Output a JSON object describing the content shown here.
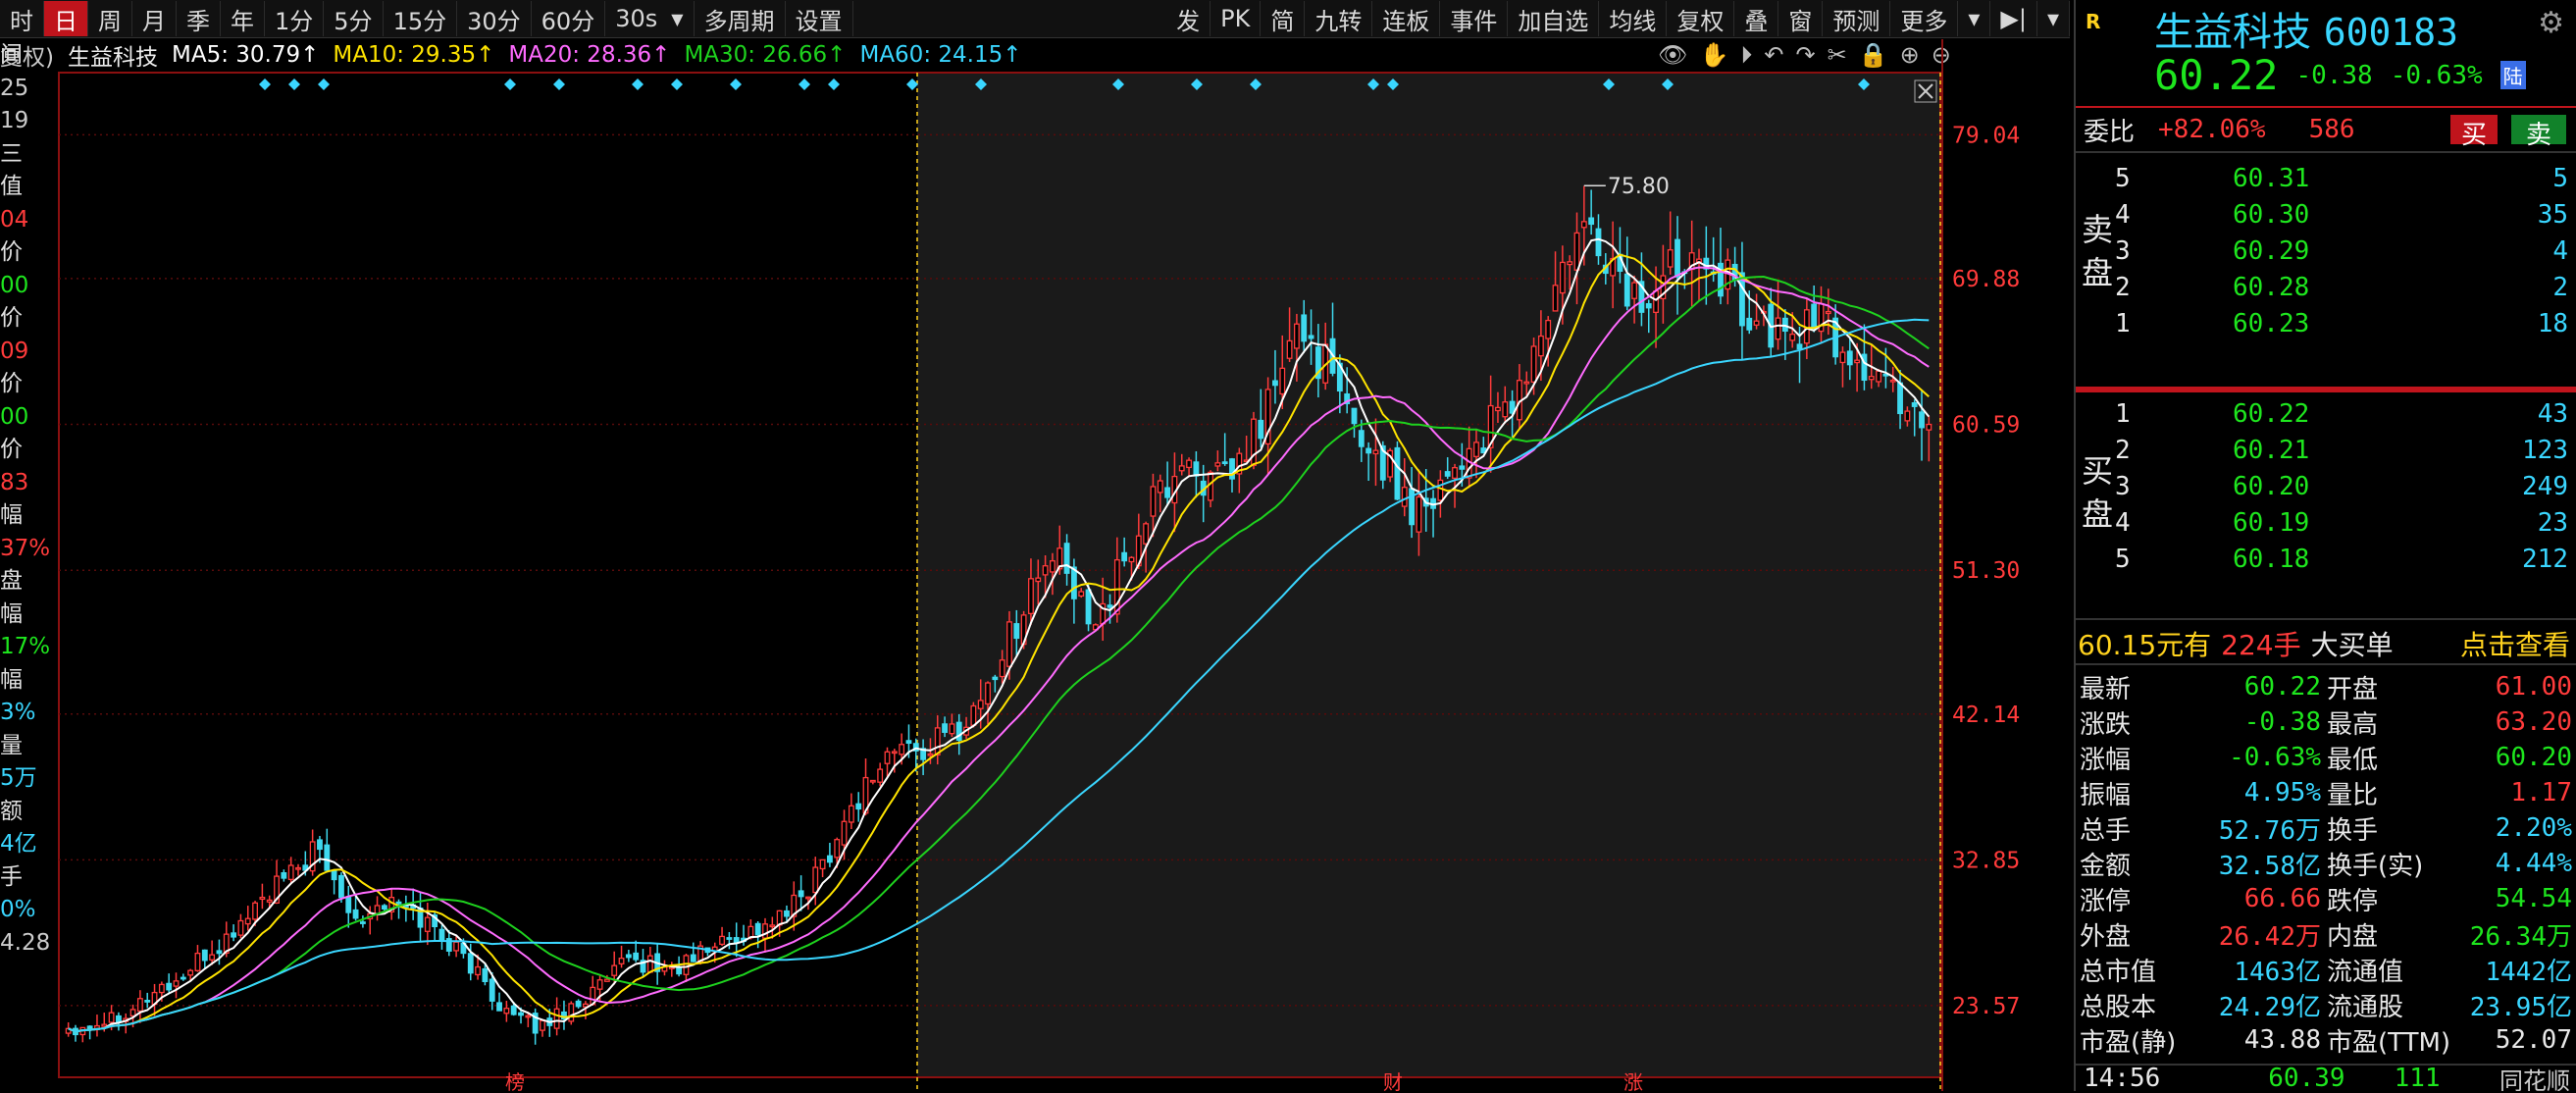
{
  "toolbar": {
    "periods": [
      "时",
      "日",
      "周",
      "月",
      "季",
      "年",
      "1分",
      "5分",
      "15分",
      "30分",
      "60分"
    ],
    "active_period": "日",
    "interval": "30s",
    "multi_period": "多周期",
    "settings": "设置",
    "right_items": [
      "发",
      "PK",
      "简",
      "九转",
      "连板",
      "事件",
      "加自选",
      "均线",
      "复权",
      "叠",
      "窗",
      "预测",
      "更多"
    ]
  },
  "ma_bar": {
    "prefix": "复权)",
    "stock_name": "生益科技",
    "ma5": "MA5: 30.79↑",
    "ma10": "MA10: 29.35↑",
    "ma20": "MA20: 28.36↑",
    "ma30": "MA30: 26.66↑",
    "ma60": "MA60: 24.15↑"
  },
  "left_panel": [
    "间",
    "25",
    "19",
    "三",
    "值",
    "04",
    "价",
    "00",
    "价",
    "09",
    "价",
    "00",
    "价",
    "83",
    "幅",
    "37%",
    "盘",
    "幅",
    "17%",
    "幅",
    "3%",
    "量",
    "5万",
    "额",
    "4亿",
    "手",
    "0%",
    "4.28"
  ],
  "y_axis": [
    "79.04",
    "69.88",
    "60.59",
    "51.30",
    "42.14",
    "32.85",
    "23.57"
  ],
  "high_label": "75.80",
  "bottom_marks": [
    "榜",
    "财",
    "涨"
  ],
  "colors": {
    "up": "#ff3b3b",
    "down": "#3fd9ee",
    "ma5": "#ffffff",
    "ma10": "#ffe400",
    "ma20": "#ff6bff",
    "ma30": "#1ed21e",
    "ma60": "#3ad6ff"
  },
  "chart_data": {
    "type": "candlestick",
    "ylim": [
      19.0,
      83.0
    ],
    "y_ticks": [
      79.04,
      69.88,
      60.59,
      51.3,
      42.14,
      32.85,
      23.57
    ],
    "ma_labels": [
      "MA5",
      "MA10",
      "MA20",
      "MA30",
      "MA60"
    ],
    "ma_values_last": [
      30.79,
      29.35,
      28.36,
      26.66,
      24.15
    ],
    "high_annotation": 75.8,
    "close_path": [
      22.2,
      22.4,
      22.9,
      23.6,
      24.6,
      25.2,
      26.6,
      27.6,
      29.4,
      30.8,
      31.9,
      33.5,
      31.2,
      29.1,
      30.2,
      29.8,
      28.9,
      27.6,
      26.1,
      24.1,
      22.6,
      22.2,
      23.2,
      24.0,
      25.1,
      26.4,
      26.2,
      25.8,
      26.7,
      27.6,
      28.1,
      28.6,
      29.3,
      31.1,
      33.6,
      36.3,
      38.6,
      40.1,
      39.7,
      40.6,
      41.6,
      43.9,
      47.1,
      50.4,
      52.3,
      49.3,
      48.6,
      51.3,
      54.6,
      56.9,
      58.3,
      56.6,
      57.3,
      60.1,
      63.6,
      66.8,
      64.6,
      61.1,
      59.3,
      57.6,
      55.3,
      56.6,
      58.3,
      59.6,
      61.1,
      63.6,
      67.4,
      71.4,
      72.8,
      70.3,
      68.3,
      69.3,
      71.8,
      72.4,
      69.6,
      67.6,
      66.3,
      66.4,
      67.4,
      65.6,
      64.4,
      63.1,
      62.2,
      60.59
    ]
  },
  "quote": {
    "badge": "R",
    "name": "生益科技",
    "code": "600183",
    "price": "60.22",
    "change": "-0.38",
    "pct": "-0.63%",
    "lu": "陆",
    "weibi_label": "委比",
    "weibi_value": "+82.06%",
    "weibi_diff": "586",
    "buy_btn": "买",
    "sell_btn": "卖",
    "sell_label": [
      "卖",
      "盘"
    ],
    "buy_label": [
      "买",
      "盘"
    ],
    "asks": [
      {
        "level": "5",
        "price": "60.31",
        "vol": "5"
      },
      {
        "level": "4",
        "price": "60.30",
        "vol": "35"
      },
      {
        "level": "3",
        "price": "60.29",
        "vol": "4"
      },
      {
        "level": "2",
        "price": "60.28",
        "vol": "2"
      },
      {
        "level": "1",
        "price": "60.23",
        "vol": "18"
      }
    ],
    "bids": [
      {
        "level": "1",
        "price": "60.22",
        "vol": "43"
      },
      {
        "level": "2",
        "price": "60.21",
        "vol": "123"
      },
      {
        "level": "3",
        "price": "60.20",
        "vol": "249"
      },
      {
        "level": "4",
        "price": "60.19",
        "vol": "23"
      },
      {
        "level": "5",
        "price": "60.18",
        "vol": "212"
      }
    ],
    "big_order": {
      "price": "60.15元有",
      "amount": "224手",
      "label": "大买单",
      "link": "点击查看"
    },
    "stats": [
      [
        "最新",
        "60.22",
        "开盘",
        "61.00"
      ],
      [
        "涨跌",
        "-0.38",
        "最高",
        "63.20"
      ],
      [
        "涨幅",
        "-0.63%",
        "最低",
        "60.20"
      ],
      [
        "振幅",
        "4.95%",
        "量比",
        "1.17"
      ],
      [
        "总手",
        "52.76万",
        "换手",
        "2.20%"
      ],
      [
        "金额",
        "32.58亿",
        "换手(实)",
        "4.44%"
      ],
      [
        "涨停",
        "66.66",
        "跌停",
        "54.54"
      ],
      [
        "外盘",
        "26.42万",
        "内盘",
        "26.34万"
      ],
      [
        "总市值",
        "1463亿",
        "流通值",
        "1442亿"
      ],
      [
        "总股本",
        "24.29亿",
        "流通股",
        "23.95亿"
      ],
      [
        "市盈(静)",
        "43.88",
        "市盈(TTM)",
        "52.07"
      ]
    ],
    "tick": {
      "time": "14:56",
      "price": "60.39",
      "vol": "111"
    },
    "logo": "同花顺"
  }
}
